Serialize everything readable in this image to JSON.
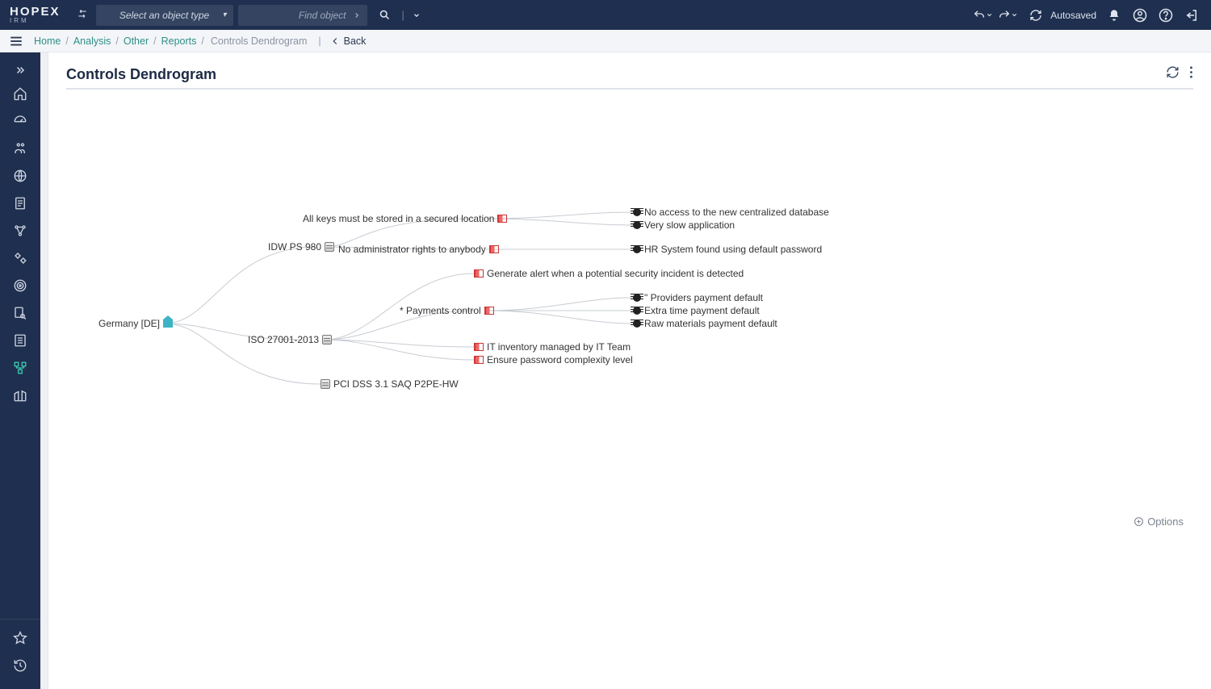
{
  "app": {
    "name": "HOPEX",
    "sub": "IRM"
  },
  "topbar": {
    "select_placeholder": "Select an object type",
    "find_placeholder": "Find object",
    "autosaved": "Autosaved"
  },
  "breadcrumbs": {
    "items": [
      "Home",
      "Analysis",
      "Other",
      "Reports"
    ],
    "current": "Controls Dendrogram",
    "back": "Back"
  },
  "page": {
    "title": "Controls Dendrogram"
  },
  "options_label": "Options",
  "dendro": {
    "root": "Germany [DE]",
    "level2": [
      "IDW PS 980",
      "ISO 27001-2013",
      "PCI DSS 3.1 SAQ P2PE-HW"
    ],
    "l3": {
      "a": "All keys must be stored in a secured location",
      "b": "No administrator rights to anybody",
      "c": "Generate alert when a potential security incident is detected",
      "d": "* Payments control",
      "e": "IT inventory managed by IT Team",
      "f": "Ensure password complexity level"
    },
    "leaves": {
      "x1": "No access to the new centralized database",
      "x2": "Very slow application",
      "x3": "HR System found using default password",
      "x4": "\" Providers payment default",
      "x5": "Extra time payment default",
      "x6": "Raw materials payment default"
    }
  }
}
